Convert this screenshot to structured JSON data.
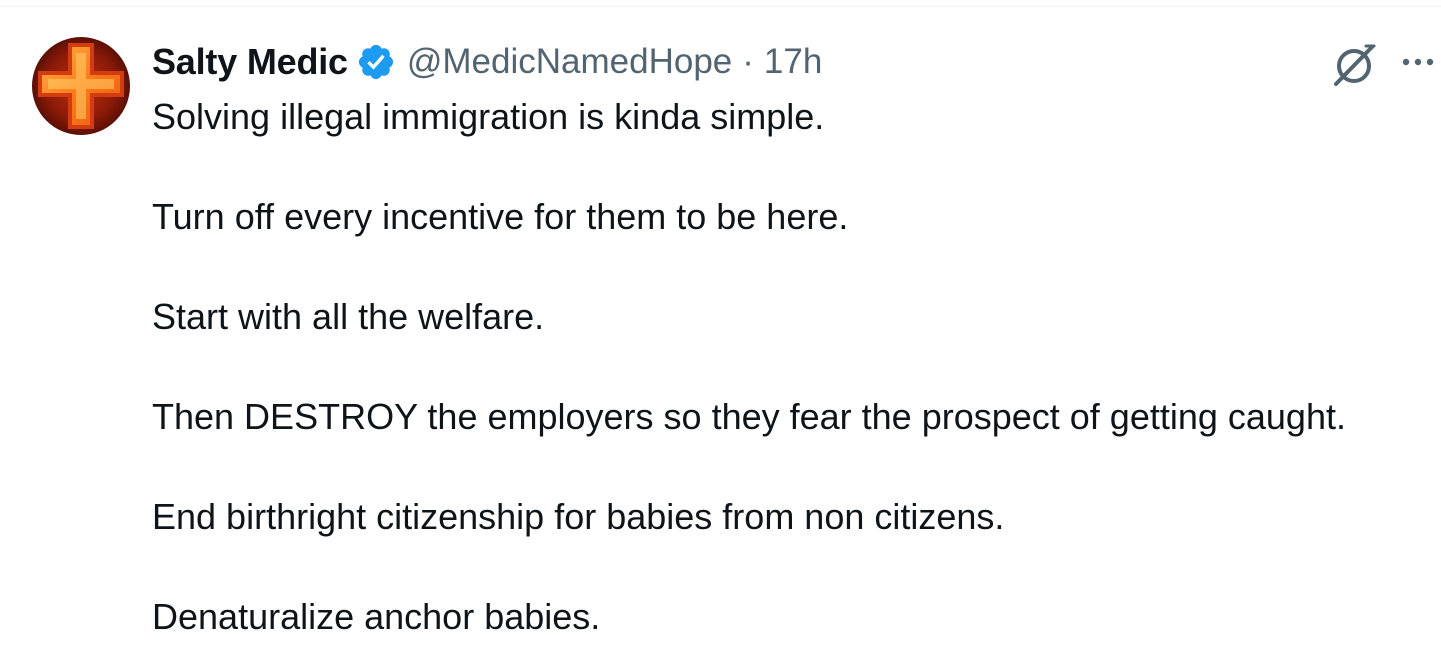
{
  "author": {
    "display_name": "Salty Medic",
    "handle": "@MedicNamedHope",
    "separator": "·",
    "timestamp": "17h",
    "verified": true,
    "avatar": "red-cross-avatar"
  },
  "icons": {
    "verified": "verified-badge-icon",
    "grok": "grok-icon",
    "more": "more-options-icon"
  },
  "colors": {
    "text": "#0f1419",
    "secondary_text": "#536471",
    "verified_blue": "#1d9bf0",
    "divider": "#eff3f4"
  },
  "tweet": {
    "paragraphs": [
      "Solving illegal immigration is kinda simple.",
      "Turn off every incentive for them to be here.",
      "Start with all the welfare.",
      "Then DESTROY the employers so they fear the prospect of getting caught.",
      "End birthright citizenship for babies from non citizens.",
      "Denaturalize anchor babies."
    ]
  }
}
